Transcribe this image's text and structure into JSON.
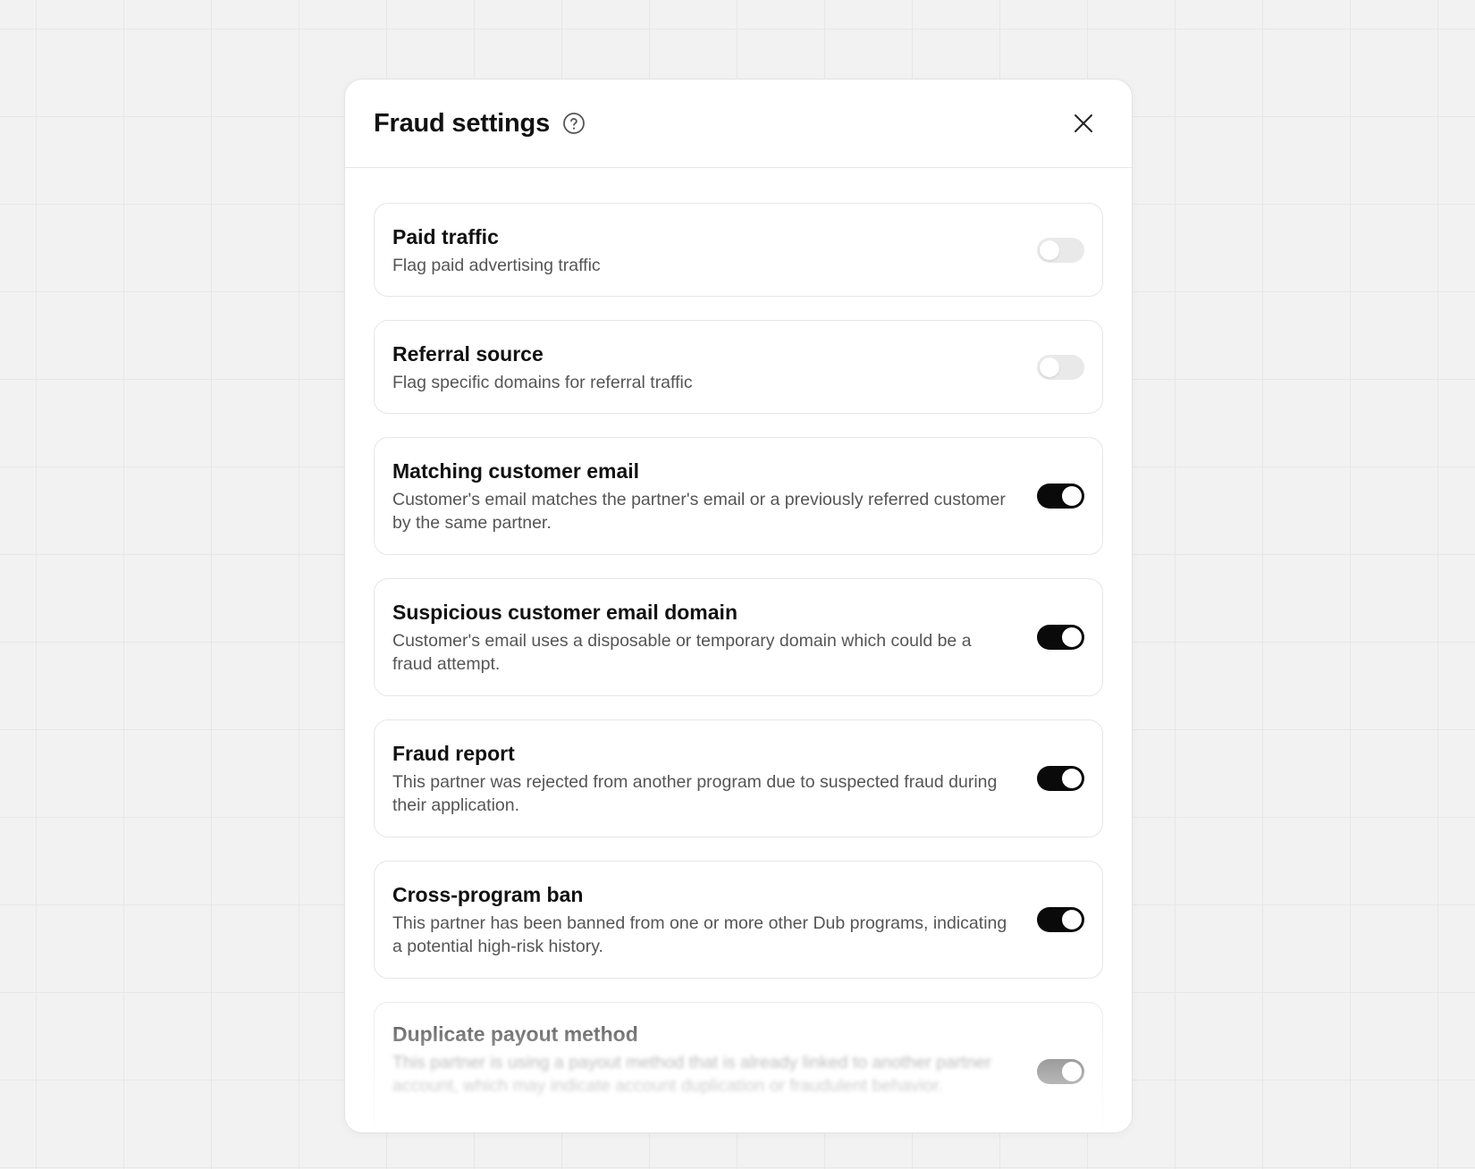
{
  "modal": {
    "title": "Fraud settings",
    "help_icon": "question-circle-icon",
    "close_icon": "close-x-icon"
  },
  "colors": {
    "toggle_on": "#0a0a0a",
    "toggle_off": "#e9e9e9",
    "background": "#f2f2f2"
  },
  "settings": [
    {
      "title": "Paid traffic",
      "description": "Flag paid advertising traffic",
      "enabled": false
    },
    {
      "title": "Referral source",
      "description": "Flag specific domains for referral traffic",
      "enabled": false
    },
    {
      "title": "Matching customer email",
      "description": "Customer's email matches the partner's email or a previously referred customer by the same partner.",
      "enabled": true
    },
    {
      "title": "Suspicious customer email domain",
      "description": "Customer's email uses a disposable or temporary domain which could be a fraud attempt.",
      "enabled": true
    },
    {
      "title": "Fraud report",
      "description": "This partner was rejected from another program due to suspected fraud during their application.",
      "enabled": true
    },
    {
      "title": "Cross-program ban",
      "description": "This partner has been banned from one or more other Dub programs, indicating a potential high-risk history.",
      "enabled": true
    },
    {
      "title": "Duplicate payout method",
      "description": "This partner is using a payout method that is already linked to another partner account, which may indicate account duplication or fraudulent behavior.",
      "enabled": true
    }
  ]
}
